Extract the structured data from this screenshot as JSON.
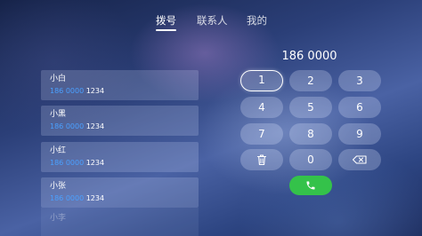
{
  "tabs": [
    {
      "label": "拨号",
      "active": true
    },
    {
      "label": "联系人",
      "active": false
    },
    {
      "label": "我的",
      "active": false
    }
  ],
  "dial": {
    "display": "186 0000"
  },
  "contacts": [
    {
      "name": "小白",
      "number_match": "186 0000",
      "number_rest": " 1234"
    },
    {
      "name": "小黑",
      "number_match": "186 0000",
      "number_rest": " 1234"
    },
    {
      "name": "小红",
      "number_match": "186 0000",
      "number_rest": " 1234"
    },
    {
      "name": "小张",
      "number_match": "186 0000",
      "number_rest": " 1234"
    },
    {
      "name": "小李"
    }
  ],
  "keypad": {
    "keys": [
      "1",
      "2",
      "3",
      "4",
      "5",
      "6",
      "7",
      "8",
      "9",
      "0"
    ],
    "selected_key": "1",
    "delete_icon": "trash-icon",
    "backspace_icon": "backspace-icon",
    "call_icon": "phone-icon"
  },
  "colors": {
    "match_highlight": "#4aa0ff",
    "call_button": "#34c24a"
  }
}
